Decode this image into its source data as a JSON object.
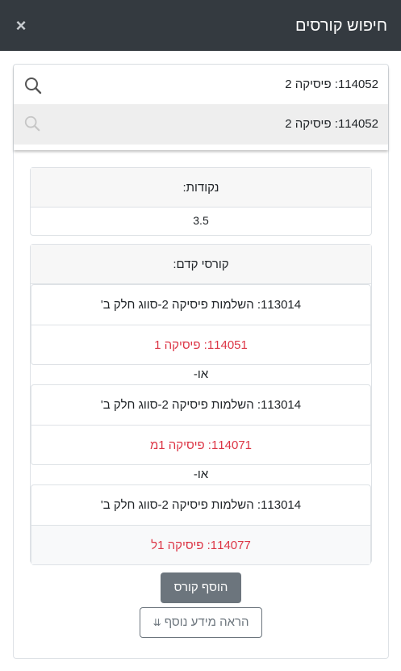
{
  "modal": {
    "title": "חיפוש קורסים",
    "close_glyph": "×"
  },
  "search": {
    "value": "114052: פיסיקה 2",
    "suggestion": "114052: פיסיקה 2"
  },
  "points": {
    "header": "נקודות:",
    "value": "3.5"
  },
  "prereqs": {
    "header": "קורסי קדם:",
    "or_label": "או-",
    "groups": [
      {
        "required": "113014: השלמות פיסיקה 2-סווג חלק ב'",
        "alternative": "114051: פיסיקה 1"
      },
      {
        "required": "113014: השלמות פיסיקה 2-סווג חלק ב'",
        "alternative": "114071: פיסיקה 1מ"
      },
      {
        "required": "113014: השלמות פיסיקה 2-סווג חלק ב'",
        "alternative": "114077: פיסיקה 1ל"
      }
    ]
  },
  "actions": {
    "add_course": "הוסף קורס",
    "show_more": "הראה מידע נוסף",
    "show_more_icon": "⇊"
  },
  "colors": {
    "header_bg": "#343a40",
    "missing": "#dc3545",
    "secondary": "#6c757d"
  }
}
